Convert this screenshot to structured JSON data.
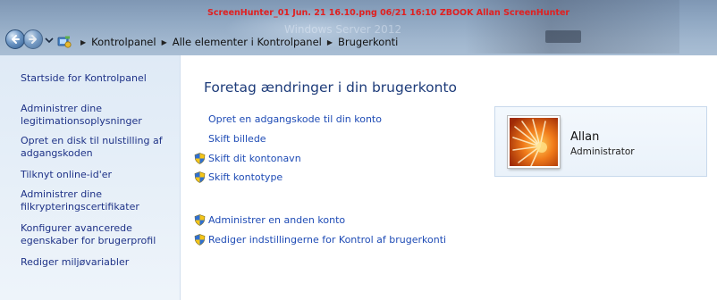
{
  "watermark": "ScreenHunter_01 Jun. 21 16.10.png  06/21  16:10  ZBOOK  Allan  ScreenHunter",
  "background_ghost_text": "Windows Server 2012",
  "breadcrumb": {
    "icon": "control-panel-icon",
    "items": [
      "Kontrolpanel",
      "Alle elementer i Kontrolpanel",
      "Brugerkonti"
    ]
  },
  "sidebar": {
    "items": [
      {
        "label": "Startside for Kontrolpanel"
      },
      {
        "label": "Administrer dine legitimationsoplysninger"
      },
      {
        "label": "Opret en disk til nulstilling af adgangskoden"
      },
      {
        "label": "Tilknyt online-id'er"
      },
      {
        "label": "Administrer dine filkrypteringscertifikater"
      },
      {
        "label": "Konfigurer avancerede egenskaber for brugerprofil"
      },
      {
        "label": "Rediger miljøvariabler"
      }
    ]
  },
  "main": {
    "heading": "Foretag ændringer i din brugerkonto",
    "links": [
      {
        "label": "Opret en adgangskode til din konto",
        "icon": ""
      },
      {
        "label": "Skift billede",
        "icon": ""
      },
      {
        "label": "Skift dit kontonavn",
        "icon": "uac-shield-icon"
      },
      {
        "label": "Skift kontotype",
        "icon": "uac-shield-icon"
      },
      {
        "label": "Administrer en anden konto",
        "icon": "uac-shield-icon"
      },
      {
        "label": "Rediger indstillingerne for Kontrol af brugerkonti",
        "icon": "uac-shield-icon"
      }
    ]
  },
  "user": {
    "name": "Allan",
    "role": "Administrator",
    "picture": "flower-avatar"
  },
  "colors": {
    "link": "#1e4bb5",
    "sidebar_link": "#1e3287",
    "heading": "#1e3c7a",
    "watermark": "#e02020"
  }
}
